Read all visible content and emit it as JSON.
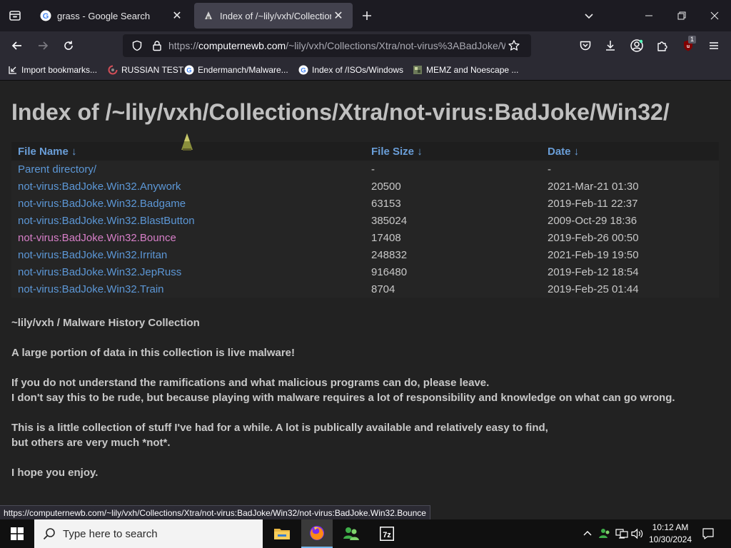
{
  "tabs": [
    {
      "title": "grass - Google Search",
      "active": false
    },
    {
      "title": "Index of /~lily/vxh/Collections/",
      "active": true
    }
  ],
  "url": {
    "scheme": "https://",
    "host": "computernewb.com",
    "path": "/~lily/vxh/Collections/Xtra/not-virus%3ABadJoke/W"
  },
  "extension_badge": "1",
  "bookmarks": [
    "Import bookmarks...",
    "RUSSIAN TEST",
    "Endermanch/Malware...",
    "Index of /ISOs/Windows",
    "MEMZ and Noescape ..."
  ],
  "page": {
    "title": "Index of /~lily/vxh/Collections/Xtra/not-virus:BadJoke/Win32/",
    "columns": {
      "name": "File Name  ↓",
      "size": "File Size  ↓",
      "date": "Date  ↓"
    },
    "rows": [
      {
        "name": "Parent directory/",
        "size": "-",
        "date": "-",
        "visited": false,
        "parent": true
      },
      {
        "name": "not-virus:BadJoke.Win32.Anywork",
        "size": "20500",
        "date": "2021-Mar-21 01:30",
        "visited": false
      },
      {
        "name": "not-virus:BadJoke.Win32.Badgame",
        "size": "63153",
        "date": "2019-Feb-11 22:37",
        "visited": false
      },
      {
        "name": "not-virus:BadJoke.Win32.BlastButton",
        "size": "385024",
        "date": "2009-Oct-29 18:36",
        "visited": false
      },
      {
        "name": "not-virus:BadJoke.Win32.Bounce",
        "size": "17408",
        "date": "2019-Feb-26 00:50",
        "visited": true
      },
      {
        "name": "not-virus:BadJoke.Win32.Irritan",
        "size": "248832",
        "date": "2021-Feb-19 19:50",
        "visited": false
      },
      {
        "name": "not-virus:BadJoke.Win32.JepRuss",
        "size": "916480",
        "date": "2019-Feb-12 18:54",
        "visited": false
      },
      {
        "name": "not-virus:BadJoke.Win32.Train",
        "size": "8704",
        "date": "2019-Feb-25 01:44",
        "visited": false
      }
    ],
    "description": [
      "~lily/vxh / Malware History Collection",
      "A large portion of data in this collection is live malware!",
      "If you do not understand the ramifications and what malicious programs can do, please leave.",
      "I don't say this to be rude, but because playing with malware requires a lot of responsibility and knowledge on what can go wrong.",
      "This is a little collection of stuff I've had for a while. A lot is publically available and relatively easy to find,",
      "but others are very much *not*.",
      "I hope you enjoy."
    ]
  },
  "status_link": "https://computernewb.com/~lily/vxh/Collections/Xtra/not-virus:BadJoke/Win32/not-virus:BadJoke.Win32.Bounce",
  "taskbar": {
    "search_placeholder": "Type here to search",
    "time": "10:12 AM",
    "date": "10/30/2024"
  },
  "colors": {
    "link": "#5c97d6",
    "visited_link": "#d77fc8",
    "page_bg": "#222222",
    "chrome_bg": "#2b2a33"
  }
}
